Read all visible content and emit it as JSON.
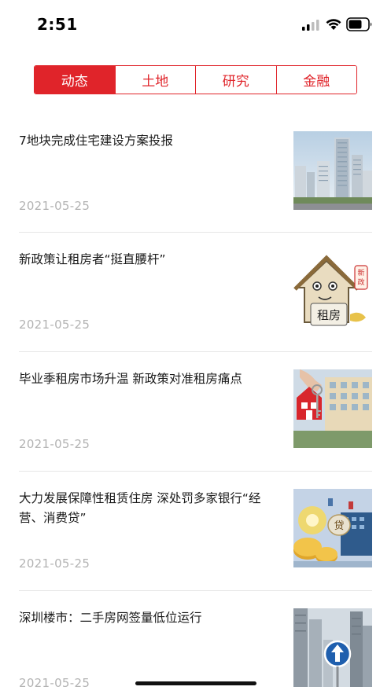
{
  "status_bar": {
    "time": "2:51"
  },
  "tabs": [
    {
      "label": "动态",
      "active": true
    },
    {
      "label": "土地",
      "active": false
    },
    {
      "label": "研究",
      "active": false
    },
    {
      "label": "金融",
      "active": false
    }
  ],
  "news": [
    {
      "title": "7地块完成住宅建设方案投报",
      "date": "2021-05-25",
      "thumb": "buildings-icon"
    },
    {
      "title": "新政策让租房者“挺直腰杆”",
      "date": "2021-05-25",
      "thumb": "rental-house-icon",
      "thumb_text": [
        "新",
        "政",
        "租房"
      ]
    },
    {
      "title": "毕业季租房市场升温 新政策对准租房痛点",
      "date": "2021-05-25",
      "thumb": "house-key-icon"
    },
    {
      "title": "大力发展保障性租赁住房 深处罚多家银行“经营、消费贷”",
      "date": "2021-05-25",
      "thumb": "loan-coins-icon",
      "thumb_text": [
        "贷"
      ]
    },
    {
      "title": "深圳楼市：二手房网签量低位运行",
      "date": "2021-05-25",
      "thumb": "city-arrow-icon"
    }
  ],
  "colors": {
    "accent": "#e0242a",
    "date": "#b3b3b3",
    "divider": "#e6e6e6"
  }
}
